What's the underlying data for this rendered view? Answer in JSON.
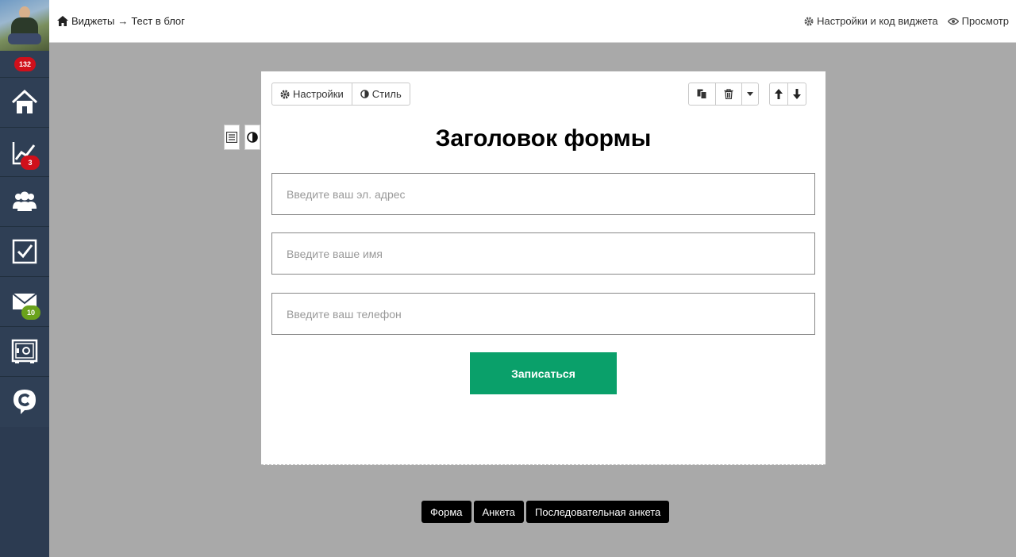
{
  "sidebar": {
    "top_badge": "132",
    "items": [
      {
        "icon": "home-icon"
      },
      {
        "icon": "chart-icon",
        "badge": "3",
        "badge_color": "#d0101b"
      },
      {
        "icon": "users-icon"
      },
      {
        "icon": "checkbox-icon"
      },
      {
        "icon": "mail-icon",
        "badge": "10",
        "badge_color": "#6aa21c"
      },
      {
        "icon": "safe-icon"
      },
      {
        "icon": "chat-c-icon"
      }
    ]
  },
  "topbar": {
    "breadcrumb": {
      "root": "Виджеты",
      "separator": "→",
      "current": "Тест в блог"
    },
    "settings_link": "Настройки и код виджета",
    "preview_link": "Просмотр"
  },
  "form": {
    "toolbar": {
      "settings": "Настройки",
      "style": "Стиль"
    },
    "title": "Заголовок формы",
    "fields": [
      {
        "placeholder": "Введите ваш эл. адрес"
      },
      {
        "placeholder": "Введите ваше имя"
      },
      {
        "placeholder": "Введите ваш телефон"
      }
    ],
    "submit": "Записаться",
    "accent_color": "#0aa06a"
  },
  "types": [
    "Форма",
    "Анкета",
    "Последовательная анкета"
  ]
}
